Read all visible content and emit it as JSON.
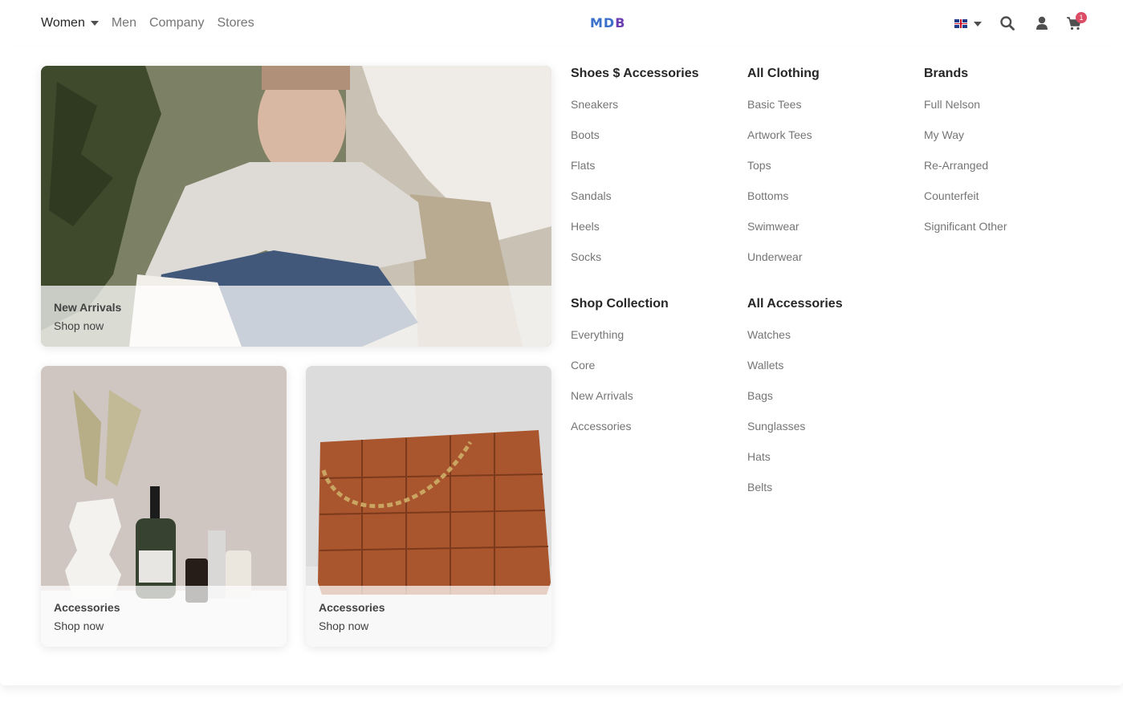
{
  "navbar": {
    "links": [
      {
        "label": "Women",
        "active": true,
        "dropdown": true
      },
      {
        "label": "Men"
      },
      {
        "label": "Company"
      },
      {
        "label": "Stores"
      }
    ],
    "brand": {
      "m": "M",
      "d": "D",
      "b": "B"
    },
    "language_flag": "uk-flag-icon",
    "icons": [
      "search-icon",
      "user-icon",
      "cart-icon"
    ],
    "cart_count": "1"
  },
  "featured": [
    {
      "title": "New Arrivals",
      "link": "Shop now",
      "image": "man-in-white-tshirt"
    },
    {
      "title": "Accessories",
      "link": "Shop now",
      "image": "vase-and-cosmetics"
    },
    {
      "title": "Accessories",
      "link": "Shop now",
      "image": "brown-woven-leather-bag"
    }
  ],
  "columns": [
    {
      "title": "Shoes $ Accessories",
      "items": [
        "Sneakers",
        "Boots",
        "Flats",
        "Sandals",
        "Heels",
        "Socks"
      ]
    },
    {
      "title": "All Clothing",
      "items": [
        "Basic Tees",
        "Artwork Tees",
        "Tops",
        "Bottoms",
        "Swimwear",
        "Underwear"
      ]
    },
    {
      "title": "Brands",
      "items": [
        "Full Nelson",
        "My Way",
        "Re-Arranged",
        "Counterfeit",
        "Significant Other"
      ]
    },
    {
      "title": "Shop Collection",
      "items": [
        "Everything",
        "Core",
        "New Arrivals",
        "Accessories"
      ]
    },
    {
      "title": "All Accessories",
      "items": [
        "Watches",
        "Wallets",
        "Bags",
        "Sunglasses",
        "Hats",
        "Belts"
      ]
    }
  ],
  "colors": {
    "text_dark": "#262626",
    "text_muted": "#757575",
    "badge": "#dc4c64",
    "brand_blue": "#3b71ca"
  }
}
